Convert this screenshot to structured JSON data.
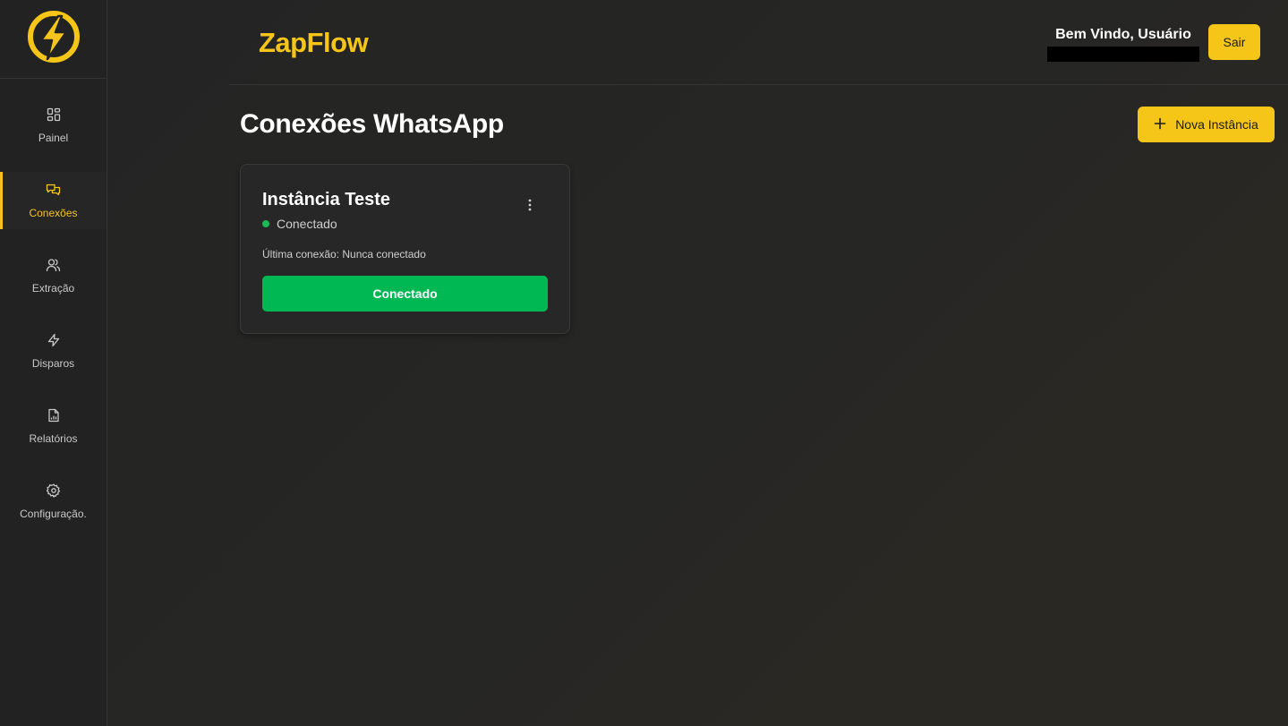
{
  "colors": {
    "accent": "#f5c518",
    "success": "#00b853",
    "background": "#232323",
    "sidebar": "#222222"
  },
  "sidebar": {
    "logo_icon": "lightning-bolt-circle-icon",
    "items": [
      {
        "label": "Painel",
        "icon": "grid-icon",
        "active": false
      },
      {
        "label": "Conexões",
        "icon": "chat-bubbles-icon",
        "active": true
      },
      {
        "label": "Extração",
        "icon": "users-icon",
        "active": false
      },
      {
        "label": "Disparos",
        "icon": "zap-icon",
        "active": false
      },
      {
        "label": "Relatórios",
        "icon": "file-chart-icon",
        "active": false
      },
      {
        "label": "Configuração.",
        "icon": "gear-icon",
        "active": false
      }
    ]
  },
  "header": {
    "brand": "ZapFlow",
    "welcome": "Bem Vindo, Usuário",
    "logout_label": "Sair"
  },
  "main": {
    "title": "Conexões WhatsApp",
    "new_instance_label": "Nova Instância",
    "instances": [
      {
        "name": "Instância Teste",
        "status": "Conectado",
        "last_connection": "Última conexão: Nunca conectado",
        "action_label": "Conectado"
      }
    ]
  }
}
